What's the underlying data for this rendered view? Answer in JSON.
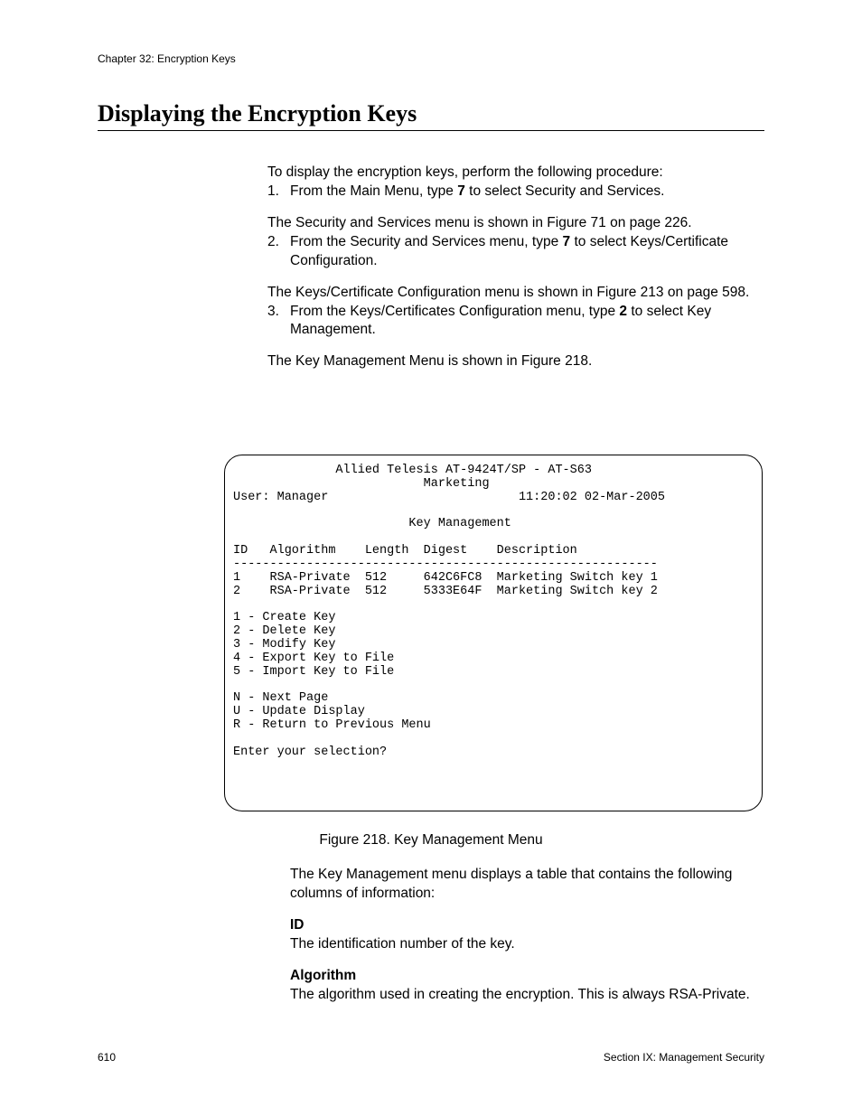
{
  "header": {
    "chapter": "Chapter 32: Encryption Keys"
  },
  "title": "Displaying the Encryption Keys",
  "intro": "To display the encryption keys, perform the following procedure:",
  "steps": {
    "s1": {
      "num": "1.",
      "text_a": "From the Main Menu, type ",
      "bold": "7",
      "text_b": " to select Security and Services.",
      "follow": "The Security and Services menu is shown in Figure 71 on page 226."
    },
    "s2": {
      "num": "2.",
      "text_a": "From the Security and Services menu, type ",
      "bold": "7",
      "text_b": " to select Keys/Certificate Configuration.",
      "follow": "The Keys/Certificate Configuration menu is shown in Figure 213 on page 598."
    },
    "s3": {
      "num": "3.",
      "text_a": "From the Keys/Certificates Configuration menu, type ",
      "bold": "2",
      "text_b": " to select Key Management.",
      "follow": "The Key Management Menu is shown in Figure 218."
    }
  },
  "menu": {
    "content": "              Allied Telesis AT-9424T/SP - AT-S63\n                          Marketing\nUser: Manager                          11:20:02 02-Mar-2005\n\n                        Key Management\n\nID   Algorithm    Length  Digest    Description\n----------------------------------------------------------\n1    RSA-Private  512     642C6FC8  Marketing Switch key 1\n2    RSA-Private  512     5333E64F  Marketing Switch key 2\n\n1 - Create Key\n2 - Delete Key\n3 - Modify Key\n4 - Export Key to File\n5 - Import Key to File\n\nN - Next Page\nU - Update Display\nR - Return to Previous Menu\n\nEnter your selection?"
  },
  "figure_caption": "Figure 218. Key Management Menu",
  "post": {
    "intro": "The Key Management menu displays a table that contains the following columns of information:",
    "terms": {
      "id": {
        "label": "ID",
        "desc": "The identification number of the key."
      },
      "algorithm": {
        "label": "Algorithm",
        "desc": "The algorithm used in creating the encryption. This is always RSA-Private."
      }
    }
  },
  "footer": {
    "page": "610",
    "section": "Section IX: Management Security"
  }
}
